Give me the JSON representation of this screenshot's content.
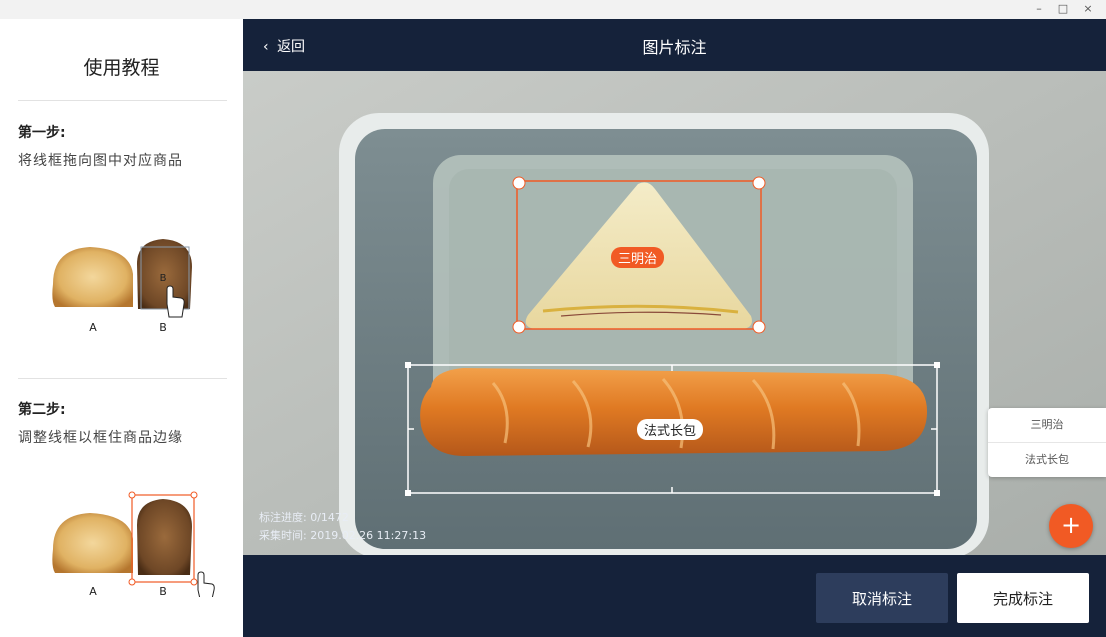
{
  "window": {
    "minimize": "–",
    "maximize": "□",
    "close": "×"
  },
  "sidebar": {
    "title": "使用教程",
    "steps": [
      {
        "title": "第一步:",
        "desc": "将线框拖向图中对应商品",
        "label_a": "A",
        "label_b": "B",
        "overlay_b": "B"
      },
      {
        "title": "第二步:",
        "desc": "调整线框以框住商品边缘",
        "label_a": "A",
        "label_b": "B"
      }
    ]
  },
  "header": {
    "back_label": "返回",
    "back_icon": "‹",
    "title": "图片标注"
  },
  "annotations": [
    {
      "label": "三明治",
      "color": "#f15a24"
    },
    {
      "label": "法式长包",
      "color": "#ffffff"
    }
  ],
  "info": {
    "progress": "标注进度: 0/1472",
    "time": "采集时间: 2019.02.26 11:27:13"
  },
  "label_list": [
    "三明治",
    "法式长包"
  ],
  "fab_icon": "+",
  "footer": {
    "cancel_label": "取消标注",
    "done_label": "完成标注"
  },
  "colors": {
    "nav": "#15223a",
    "accent": "#f15a24",
    "cancel_button": "#2d3d5c"
  }
}
